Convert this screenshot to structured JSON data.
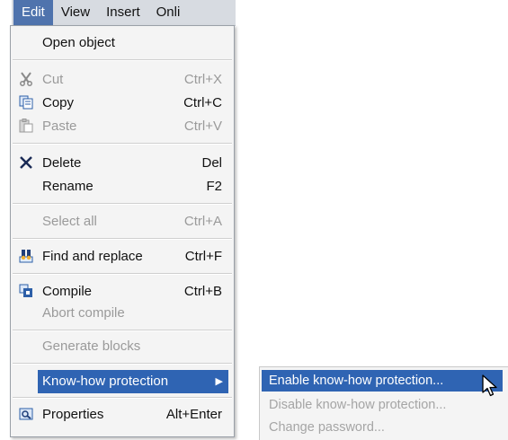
{
  "menubar": {
    "items": [
      "Edit",
      "View",
      "Insert",
      "Onli"
    ]
  },
  "menu": {
    "open_object": {
      "label": "Open object"
    },
    "cut": {
      "label": "Cut",
      "shortcut": "Ctrl+X"
    },
    "copy": {
      "label": "Copy",
      "shortcut": "Ctrl+C"
    },
    "paste": {
      "label": "Paste",
      "shortcut": "Ctrl+V"
    },
    "delete": {
      "label": "Delete",
      "shortcut": "Del"
    },
    "rename": {
      "label": "Rename",
      "shortcut": "F2"
    },
    "select_all": {
      "label": "Select all",
      "shortcut": "Ctrl+A"
    },
    "find_replace": {
      "label": "Find and replace",
      "shortcut": "Ctrl+F"
    },
    "compile": {
      "label": "Compile",
      "shortcut": "Ctrl+B"
    },
    "abort_compile": {
      "label": "Abort compile"
    },
    "generate_blocks": {
      "label": "Generate blocks"
    },
    "know_how": {
      "label": "Know-how protection"
    },
    "properties": {
      "label": "Properties",
      "shortcut": "Alt+Enter"
    }
  },
  "submenu": {
    "enable": "Enable know-how protection...",
    "disable": "Disable know-how protection...",
    "change_password": "Change password..."
  },
  "icons": {
    "cut": "scissors-icon",
    "copy": "copy-icon",
    "paste": "paste-icon",
    "delete": "delete-x-icon",
    "find_replace": "binoculars-icon",
    "compile": "compile-icon",
    "properties": "properties-icon",
    "submenu_arrow": "chevron-right-icon",
    "cursor": "mouse-pointer-icon"
  },
  "colors": {
    "highlight": "#2f64b3",
    "menubar_active": "#4f73ad",
    "menubar_bg": "#d7dbe1",
    "menu_bg": "#f4f4f4",
    "disabled_text": "#9a9a9a"
  }
}
